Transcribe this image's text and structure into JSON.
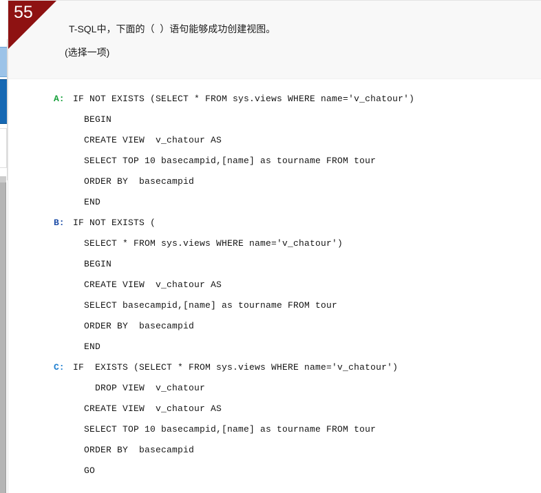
{
  "badge": {
    "number": "55"
  },
  "question": {
    "stem": "T-SQL中，下面的（  ）语句能够成功创建视图。",
    "select_hint": "(选择一项)"
  },
  "colors": {
    "badge_red": "#8e1212",
    "letter_a": "#16a03a",
    "letter_b": "#1f4fa8",
    "letter_c": "#1f7fd0",
    "header_bg": "#f8f8f8",
    "body_bg": "#ffffff",
    "tab_active_blue": "#1668b3",
    "tab_inactive_blue": "#9cc3e8",
    "scrollbar_gray": "#b5b5b5"
  },
  "options": [
    {
      "letter": "A:",
      "lines": [
        "IF NOT EXISTS (SELECT * FROM sys.views WHERE name='v_chatour')",
        "  BEGIN",
        "  CREATE VIEW  v_chatour AS",
        "  SELECT TOP 10 basecampid,[name] as tourname FROM tour",
        "  ORDER BY  basecampid",
        "  END"
      ]
    },
    {
      "letter": "B:",
      "lines": [
        "IF NOT EXISTS (",
        "  SELECT * FROM sys.views WHERE name='v_chatour')",
        "  BEGIN",
        "  CREATE VIEW  v_chatour AS",
        "  SELECT basecampid,[name] as tourname FROM tour",
        "  ORDER BY  basecampid",
        "  END"
      ]
    },
    {
      "letter": "C:",
      "lines": [
        "IF  EXISTS (SELECT * FROM sys.views WHERE name='v_chatour')",
        "    DROP VIEW  v_chatour",
        "  CREATE VIEW  v_chatour AS",
        "  SELECT TOP 10 basecampid,[name] as tourname FROM tour",
        "  ORDER BY  basecampid",
        "  GO"
      ]
    }
  ]
}
